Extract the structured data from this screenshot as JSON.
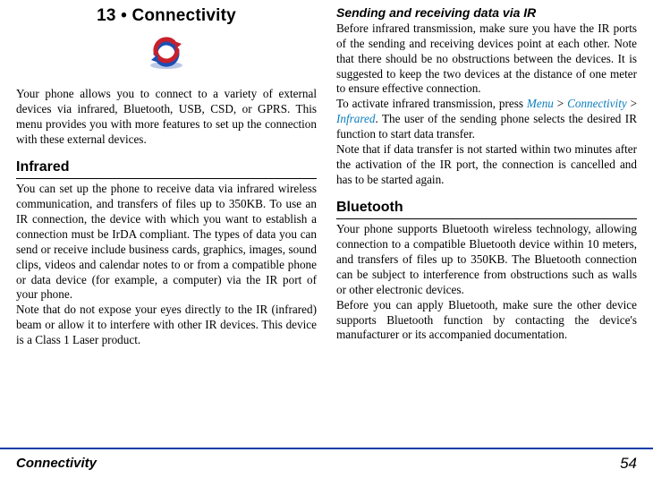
{
  "left": {
    "chapter_title": "13 • Connectivity",
    "intro": "Your phone allows you to connect to a variety of external devices via infrared, Bluetooth, USB, CSD, or GPRS. This menu provides you with more features to set up the connection with these external devices.",
    "infrared_head": "Infrared",
    "infrared_p1": "You can set up the phone to receive data via infrared wireless communication, and transfers of files up to 350KB. To use an IR connection, the device with which you want to establish a connection must be IrDA compliant. The types of data you can send or receive include business cards, graphics, images, sound clips, videos and calendar notes to or from a compatible phone or data device (for example, a computer) via the IR port of your phone.",
    "infrared_p2": "Note that do not expose your eyes directly to the IR (infrared) beam or allow it to interfere with other IR devices. This device is a Class 1 Laser product."
  },
  "right": {
    "subhead": "Sending and receiving data via IR",
    "p1": "Before infrared transmission, make sure you have the IR ports of the sending and receiving devices point at each other. Note that there should be no obstructions between the devices. It is suggested to keep the two devices at the distance of one meter to ensure effective connection.",
    "p2a": "To activate infrared transmission, press ",
    "menu_path": {
      "a": "Menu",
      "b": "Connectivity",
      "c": "Infrared"
    },
    "p2b": ". The user of the sending phone selects the desired IR function to start data transfer.",
    "p3": "Note that if data transfer is not started within two minutes after the activation of the IR port, the connection is cancelled and has to be started again.",
    "bt_head": "Bluetooth",
    "bt_p1": "Your phone supports Bluetooth wireless technology, allowing connection to a compatible Bluetooth device within 10 meters, and transfers of files up to 350KB. The Bluetooth connection can be subject to interference from obstructions such as walls or other electronic devices.",
    "bt_p2": "Before you can apply Bluetooth, make sure the other device supports Bluetooth function by contacting the device's manufacturer or its accompanied documentation."
  },
  "footer": {
    "section": "Connectivity",
    "page": "54"
  }
}
